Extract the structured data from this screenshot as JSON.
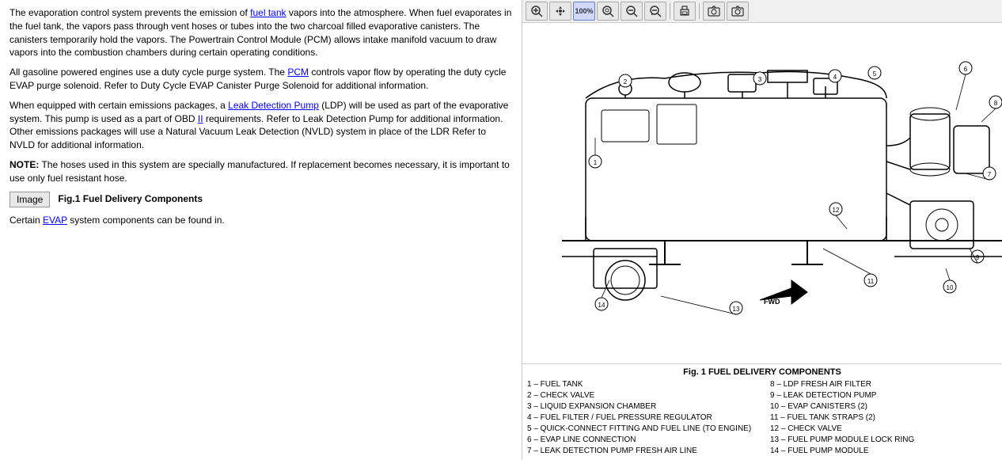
{
  "left": {
    "paragraph1": "The evaporation control system prevents the emission of ",
    "fuel_tank_link": "fuel tank",
    "paragraph1b": " vapors into the atmosphere. When fuel evaporates in the fuel tank, the vapors pass through vent hoses or tubes into the two charcoal filled evaporative canisters. The canisters temporarily hold the vapors. The Powertrain Control Module (PCM) allows intake manifold vacuum to draw vapors into the combustion chambers during certain operating conditions.",
    "paragraph2a": "All gasoline powered engines use a duty cycle purge system. The ",
    "pcm_link": "PCM",
    "paragraph2b": " controls vapor flow by operating the duty cycle EVAP purge solenoid. Refer to Duty Cycle EVAP Canister Purge Solenoid for additional information.",
    "paragraph3a": "When equipped with certain emissions packages, a ",
    "ldp_link": "Leak Detection Pump",
    "paragraph3b": " (LDP) will be used as part of the evaporative system. This pump is used as a part of OBD ",
    "obd_link": "II",
    "paragraph3c": " requirements. Refer to Leak Detection Pump for additional information. Other emissions packages will use a Natural Vacuum Leak Detection (NVLD) system in place of the LDR Refer to NVLD for additional information.",
    "note": "NOTE:",
    "note_text": "  The hoses used in this system are specially manufactured. If replacement becomes necessary, it is important to use only fuel resistant hose.",
    "image_button": "Image",
    "fig_label": "Fig.1 Fuel Delivery Components",
    "paragraph4a": "Certain EVAP system components can be found in."
  },
  "toolbar": {
    "buttons": [
      {
        "label": "🔍+",
        "name": "zoom-in",
        "active": false
      },
      {
        "label": "✛",
        "name": "pan",
        "active": false
      },
      {
        "label": "100%",
        "name": "zoom-100",
        "active": true
      },
      {
        "label": "🔍",
        "name": "zoom-fit",
        "active": false
      },
      {
        "label": "🔍-",
        "name": "zoom-out-page",
        "active": false
      },
      {
        "label": "🔍−",
        "name": "zoom-out",
        "active": false
      },
      {
        "label": "🖨",
        "name": "print",
        "active": false
      },
      {
        "label": "📷",
        "name": "camera1",
        "active": false
      },
      {
        "label": "📷",
        "name": "camera2",
        "active": false
      }
    ]
  },
  "diagram": {
    "fig_title": "Fig. 1  FUEL DELIVERY COMPONENTS",
    "legend": [
      {
        "number": "1",
        "label": "FUEL TANK"
      },
      {
        "number": "2",
        "label": "CHECK VALVE"
      },
      {
        "number": "3",
        "label": "LIQUID EXPANSION CHAMBER"
      },
      {
        "number": "4",
        "label": "FUEL FILTER / FUEL PRESSURE REGULATOR"
      },
      {
        "number": "5",
        "label": "QUICK-CONNECT FITTING AND FUEL LINE (TO ENGINE)"
      },
      {
        "number": "6",
        "label": "EVAP LINE CONNECTION"
      },
      {
        "number": "7",
        "label": "LEAK DETECTION PUMP FRESH AIR LINE"
      },
      {
        "number": "8",
        "label": "LDP FRESH AIR FILTER"
      },
      {
        "number": "9",
        "label": "LEAK DETECTION PUMP"
      },
      {
        "number": "10",
        "label": "EVAP CANISTERS (2)"
      },
      {
        "number": "11",
        "label": "FUEL TANK STRAPS (2)"
      },
      {
        "number": "12",
        "label": "CHECK VALVE"
      },
      {
        "number": "13",
        "label": "FUEL PUMP MODULE LOCK RING"
      },
      {
        "number": "14",
        "label": "FUEL PUMP MODULE"
      }
    ]
  }
}
